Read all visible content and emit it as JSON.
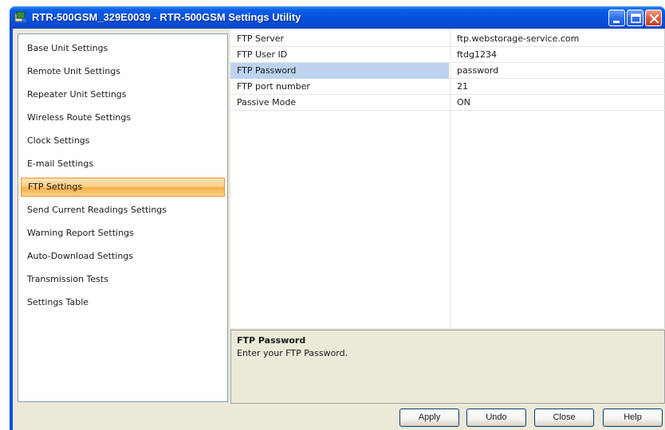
{
  "window": {
    "title": "RTR-500GSM_329E0039 - RTR-500GSM Settings Utility"
  },
  "title_buttons": {
    "minimize_icon": "minimize-icon",
    "maximize_icon": "maximize-icon",
    "close_icon": "close-icon"
  },
  "nav": {
    "items": [
      {
        "label": "Base Unit Settings"
      },
      {
        "label": "Remote Unit Settings"
      },
      {
        "label": "Repeater Unit Settings"
      },
      {
        "label": "Wireless Route Settings"
      },
      {
        "label": "Clock Settings"
      },
      {
        "label": "E-mail Settings"
      },
      {
        "label": "FTP Settings"
      },
      {
        "label": "Send Current Readings Settings"
      },
      {
        "label": "Warning Report Settings"
      },
      {
        "label": "Auto-Download Settings"
      },
      {
        "label": "Transmission  Tests"
      },
      {
        "label": "Settings Table"
      }
    ],
    "selected": "FTP Settings"
  },
  "settings": {
    "rows": [
      {
        "name": "FTP Server",
        "value": "ftp.webstorage-service.com"
      },
      {
        "name": "FTP User ID",
        "value": "ftdg1234"
      },
      {
        "name": "FTP Password",
        "value": "password"
      },
      {
        "name": "FTP port number",
        "value": "21"
      },
      {
        "name": "Passive Mode",
        "value": "ON"
      }
    ],
    "selected": "FTP Password"
  },
  "help": {
    "title": "FTP Password",
    "description": "Enter your FTP Password."
  },
  "buttons": {
    "apply": "Apply",
    "undo": "Undo",
    "close": "Close",
    "help": "Help"
  },
  "colors": {
    "titlebar": "#0551dd",
    "selection_nav": "#fbcf84",
    "selection_grid": "#bdd2ee",
    "client_bg": "#ece9d8"
  }
}
